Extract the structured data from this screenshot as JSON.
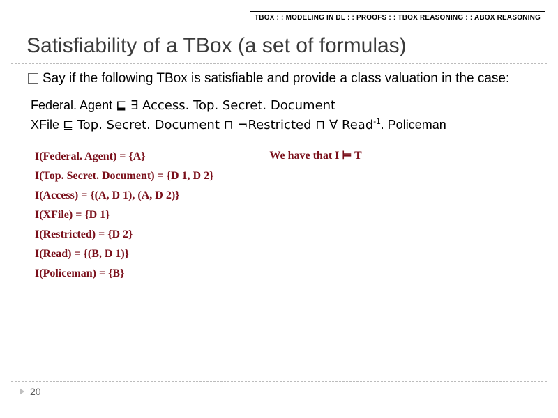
{
  "breadcrumb": {
    "items": [
      "TBOX",
      "MODELING IN DL",
      "PROOFS",
      "TBOX REASONING",
      "ABOX REASONING"
    ],
    "sep": " : : "
  },
  "title": "Satisfiability of a TBox (a set of formulas)",
  "prompt": "Say if the following TBox is satisfiable and provide a class valuation in the case:",
  "formulas": {
    "line1_a": "Federal. Agent ",
    "line1_sub": "⊑",
    "line1_b": " ∃ Access. Top. Secret. Document",
    "line2_a": "XFile ",
    "line2_sub": "⊑",
    "line2_b": " Top. Secret. Document ⊓ ¬Restricted ⊓ ∀ Read",
    "line2_sup": "-1",
    "line2_c": ". Policeman"
  },
  "interpretation": [
    "I(Federal. Agent) = {A}",
    "I(Top. Secret. Document) = {D 1, D 2}",
    "I(Access) = {(A, D 1), (A, D 2)}",
    "I(XFile) = {D 1}",
    "I(Restricted) = {D 2}",
    "I(Read) = {(B, D 1)}",
    "I(Policeman) = {B}"
  ],
  "conclusion": "We have that I ⊨ T",
  "page_number": "20"
}
